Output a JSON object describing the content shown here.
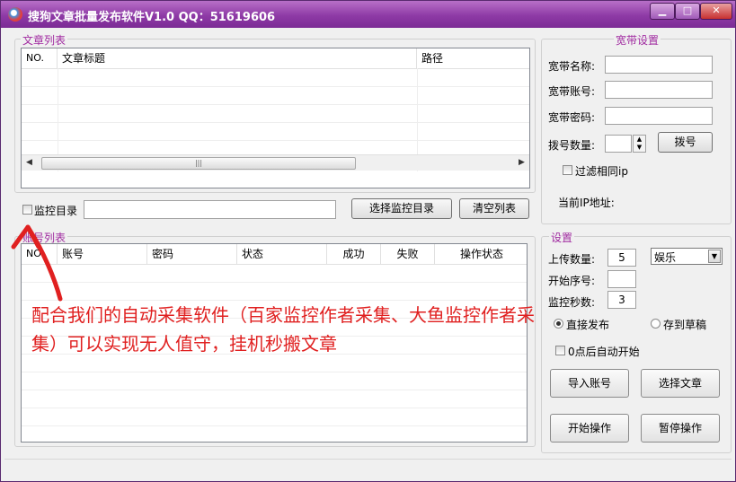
{
  "window": {
    "title": "搜狗文章批量发布软件V1.0 QQ：51619606",
    "min": "▁",
    "max": "□",
    "close": "✕"
  },
  "article_group": {
    "title": "文章列表",
    "columns": [
      "NO.",
      "文章标题",
      "路径"
    ]
  },
  "monitor": {
    "checkbox_label": "监控目录",
    "path_value": "",
    "select_button": "选择监控目录",
    "clear_button": "清空列表"
  },
  "account_group": {
    "title": "账号列表",
    "columns": [
      "NO.",
      "账号",
      "密码",
      "状态",
      "成功",
      "失败",
      "操作状态"
    ]
  },
  "broadband": {
    "title": "宽带设置",
    "name_label": "宽带名称:",
    "account_label": "宽带账号:",
    "password_label": "宽带密码:",
    "dial_count_label": "拨号数量:",
    "dial_button": "拨号",
    "filter_label": "过滤相同ip",
    "ip_label": "当前IP地址:"
  },
  "settings": {
    "title": "设置",
    "upload_count_label": "上传数量:",
    "upload_count": "5",
    "category": "娱乐",
    "start_index_label": "开始序号:",
    "start_index": "",
    "monitor_seconds_label": "监控秒数:",
    "monitor_seconds": "3",
    "direct_publish": "直接发布",
    "save_draft": "存到草稿",
    "auto_start": "0点后自动开始",
    "import_button": "导入账号",
    "choose_button": "选择文章",
    "start_button": "开始操作",
    "pause_button": "暂停操作"
  },
  "annotation": {
    "text": "配合我们的自动采集软件（百家监控作者采集、大鱼监控作者采集）可以实现无人值守，挂机秒搬文章"
  },
  "colors": {
    "title_bar": "#8e3aa6",
    "group_title": "#a02aa0",
    "annotation": "#e02020"
  }
}
